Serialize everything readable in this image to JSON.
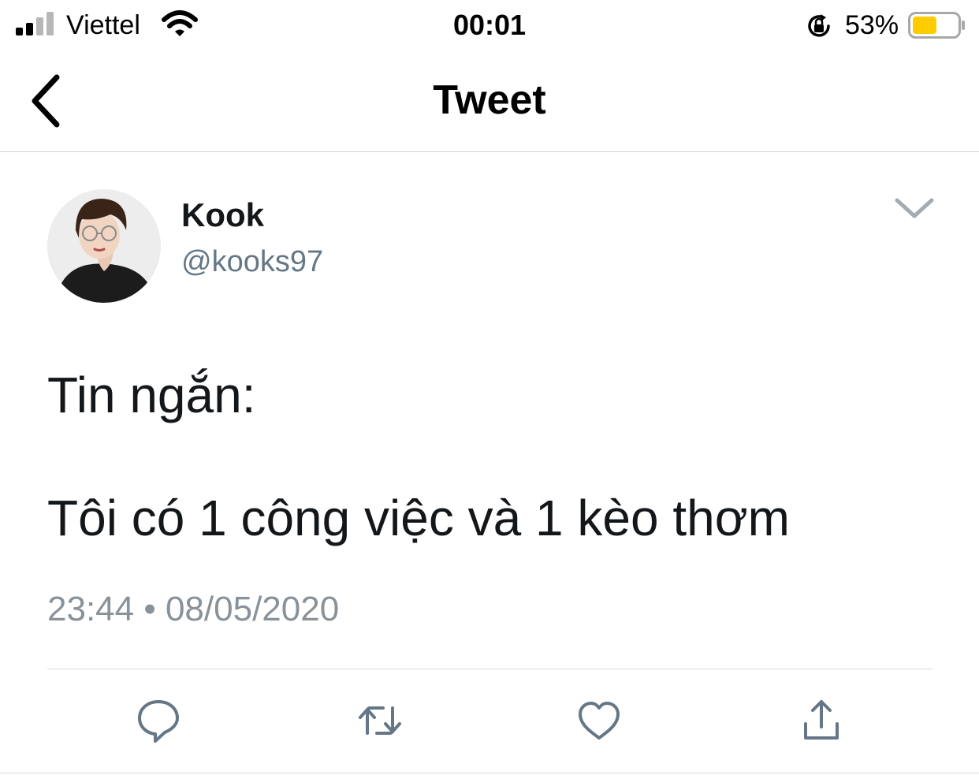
{
  "status_bar": {
    "carrier": "Viettel",
    "time": "00:01",
    "battery_percent": "53%",
    "icons": [
      "signal-icon",
      "wifi-icon",
      "orientation-lock-icon",
      "battery-icon"
    ],
    "battery_color": "#ffcc00"
  },
  "nav": {
    "title": "Tweet",
    "back_icon": "chevron-left-icon"
  },
  "tweet": {
    "author": {
      "display_name": "Kook",
      "handle": "@kooks97"
    },
    "text_lines": [
      "Tin ngắn:",
      "Tôi có 1 công việc và 1 kèo thơm"
    ],
    "timestamp": "23:44 • 08/05/2020",
    "menu_icon": "chevron-down-icon"
  },
  "actions": [
    "reply-icon",
    "retweet-icon",
    "like-icon",
    "share-icon"
  ],
  "colors": {
    "icon_gray": "#657786",
    "secondary_text": "#8a9299",
    "divider": "#d6d9db"
  }
}
